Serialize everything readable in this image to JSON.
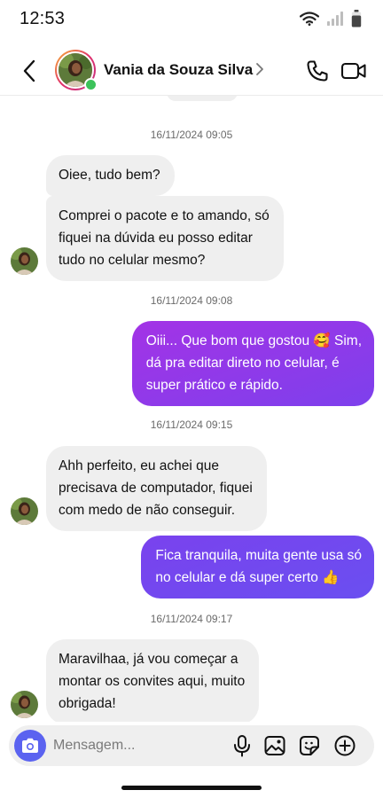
{
  "status_bar": {
    "time": "12:53"
  },
  "header": {
    "contact_name": "Vania da Souza Silva",
    "online": true
  },
  "composer": {
    "placeholder": "Mensagem..."
  },
  "thread": [
    {
      "type": "timestamp",
      "text": "16/11/2024 09:05"
    },
    {
      "type": "incoming",
      "text": "Oiee, tudo bem?"
    },
    {
      "type": "incoming",
      "lines": [
        "Comprei o pacote e to amando, só",
        "fiquei na dúvida eu posso editar",
        "tudo no celular mesmo?"
      ]
    },
    {
      "type": "timestamp",
      "text": "16/11/2024 09:08"
    },
    {
      "type": "outgoing",
      "lines": [
        "Oiii... Que bom que gostou 🥰 Sim,",
        "dá pra editar direto no celular, é",
        "super prático e rápido."
      ]
    },
    {
      "type": "timestamp",
      "text": "16/11/2024 09:15"
    },
    {
      "type": "incoming",
      "lines": [
        "Ahh perfeito, eu achei que",
        "precisava de computador, fiquei",
        "com medo de não conseguir."
      ]
    },
    {
      "type": "outgoing",
      "lines": [
        "Fica tranquila, muita gente usa só",
        "no celular e dá super certo 👍"
      ]
    },
    {
      "type": "timestamp",
      "text": "16/11/2024 09:17"
    },
    {
      "type": "incoming",
      "lines": [
        "Maravilhaa, já vou começar a",
        "montar os convites aqui, muito",
        "obrigada!"
      ]
    }
  ],
  "colors": {
    "outgoing_gradient_start": "#a333e6",
    "outgoing_gradient_end": "#6a4ff0",
    "incoming_bubble": "#efefef",
    "camera_button": "#5b63f0",
    "online_dot": "#3cc25a"
  },
  "icons": {
    "back": "chevron-left-icon",
    "call": "phone-icon",
    "video": "video-camera-icon",
    "camera": "camera-icon",
    "mic": "microphone-icon",
    "gallery": "image-icon",
    "sticker": "sticker-icon",
    "add": "plus-circle-icon"
  }
}
